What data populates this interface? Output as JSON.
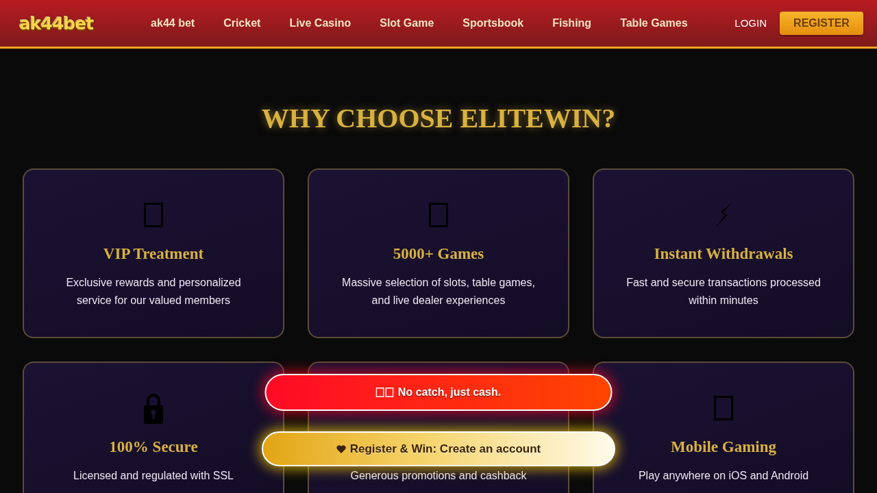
{
  "header": {
    "logo": "ak44bet",
    "nav": [
      {
        "label": "ak44 bet"
      },
      {
        "label": "Cricket"
      },
      {
        "label": "Live Casino"
      },
      {
        "label": "Slot Game"
      },
      {
        "label": "Sportsbook"
      },
      {
        "label": "Fishing"
      },
      {
        "label": "Table Games"
      }
    ],
    "login": "LOGIN",
    "register": "REGISTER"
  },
  "section": {
    "title": "WHY CHOOSE ELITEWIN?",
    "features": [
      {
        "title": "VIP Treatment",
        "description": "Exclusive rewards and personalized service for our valued members"
      },
      {
        "title": "5000+ Games",
        "description": "Massive selection of slots, table games, and live dealer experiences"
      },
      {
        "title": "Instant Withdrawals",
        "description": "Fast and secure transactions processed within minutes"
      },
      {
        "title": "100% Secure",
        "description": "Licensed and regulated with SSL"
      },
      {
        "description": "Generous promotions and cashback"
      },
      {
        "title": "Mobile Gaming",
        "description": "Play anywhere on iOS and Android"
      }
    ]
  },
  "floating_buttons": [
    {
      "kind": "alert",
      "label": "No catch, just cash."
    },
    {
      "kind": "register",
      "label": "Register & Win: Create an account"
    }
  ]
}
